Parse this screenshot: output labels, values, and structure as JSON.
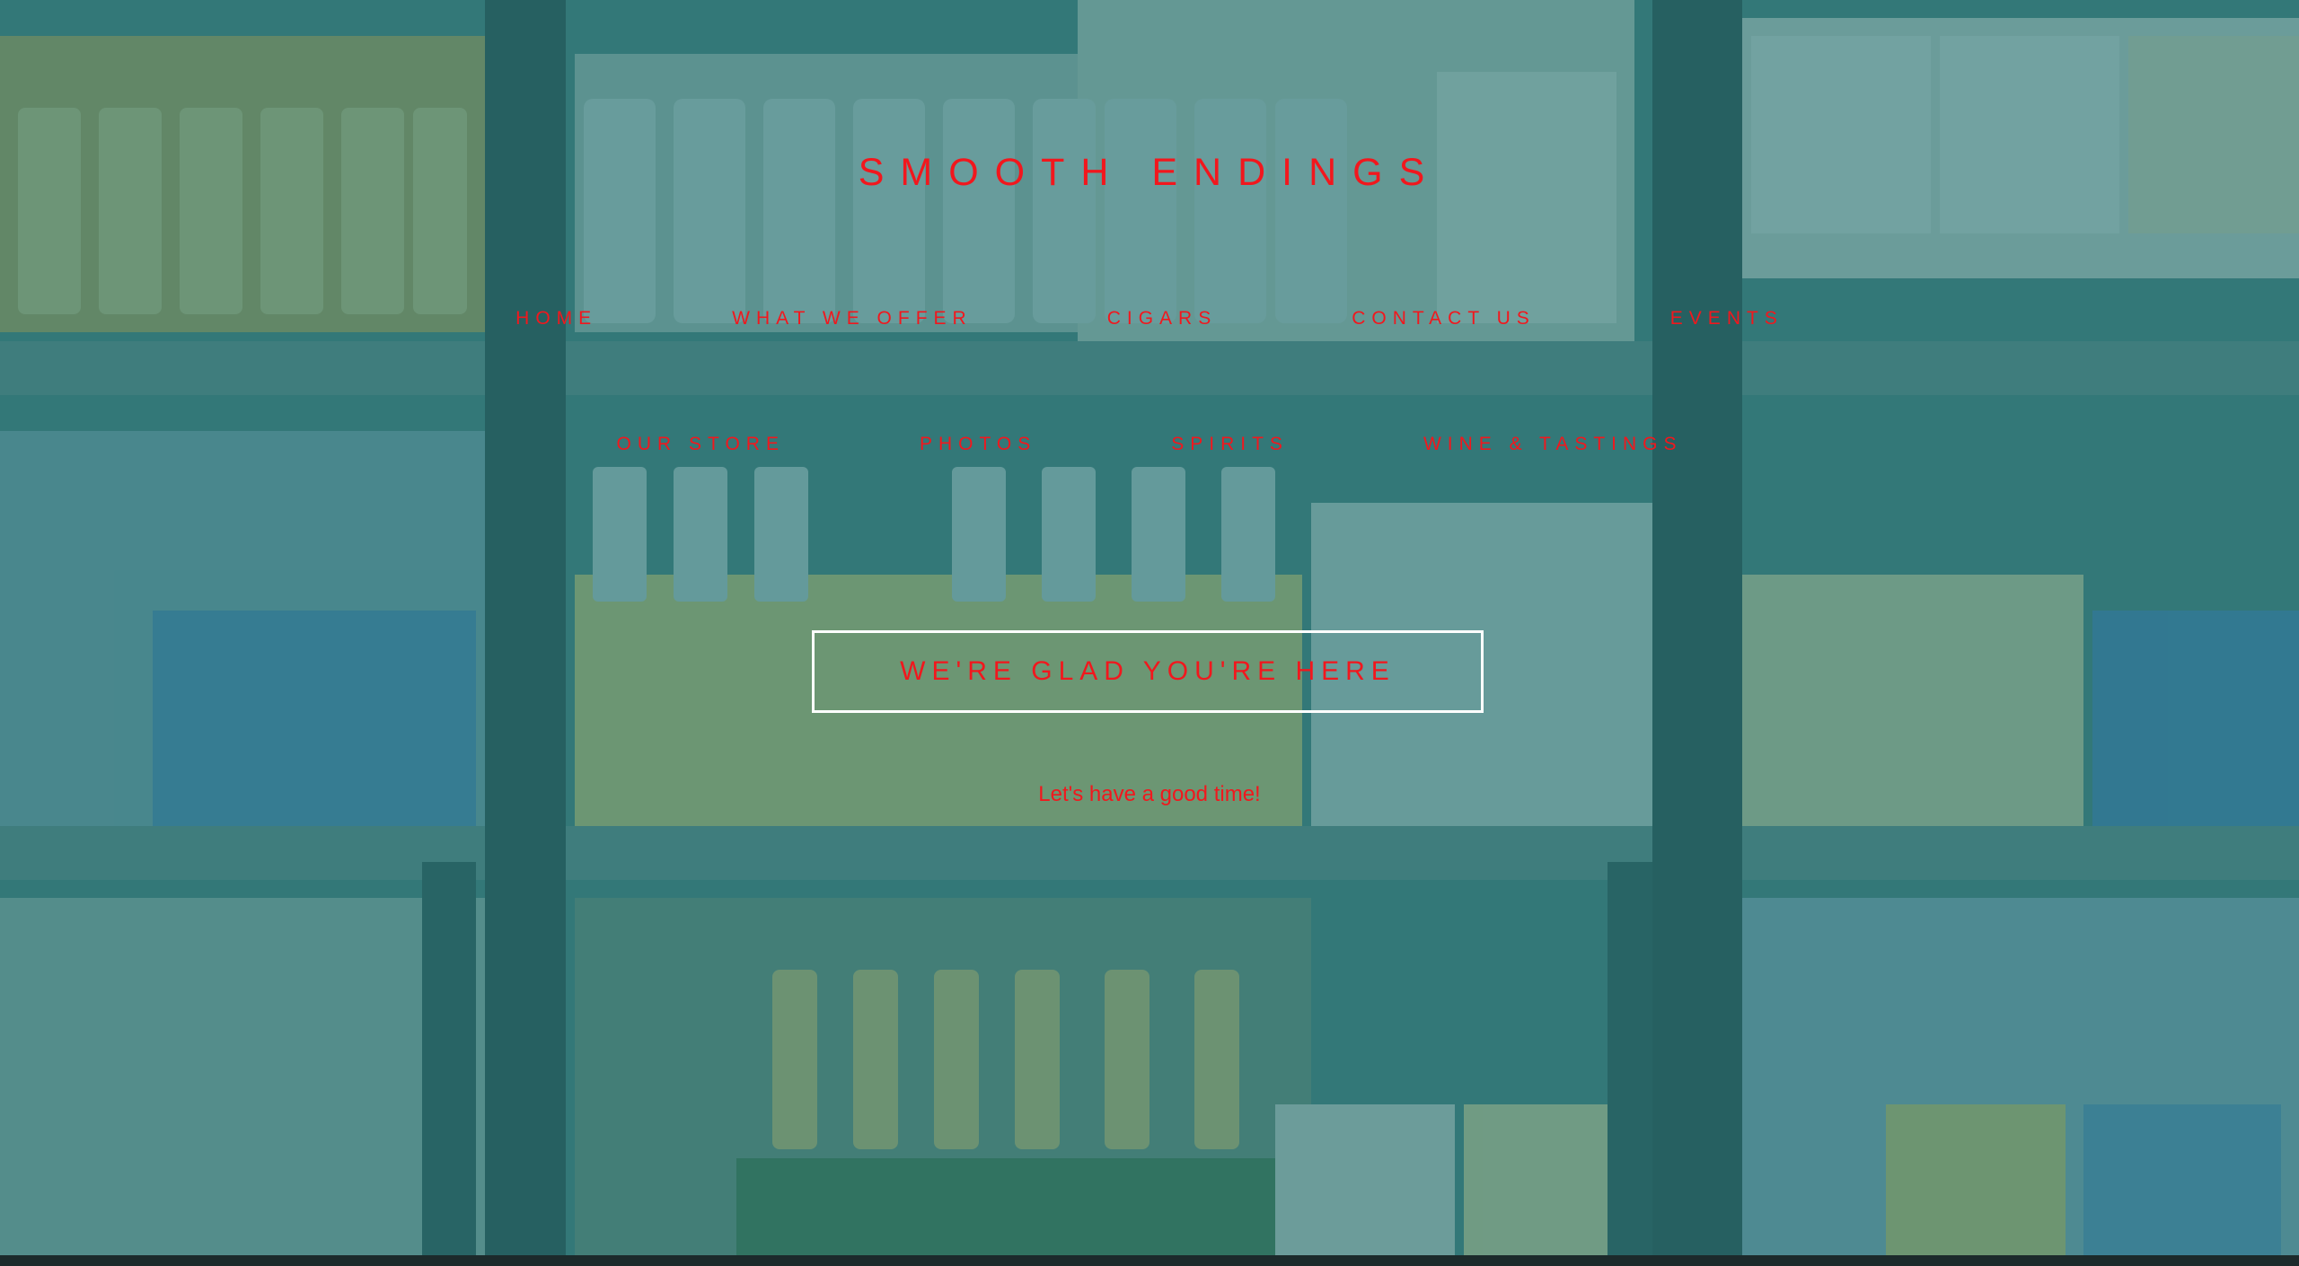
{
  "site": {
    "title": "SMOOTH ENDINGS"
  },
  "nav": {
    "row1": [
      "HOME",
      "WHAT WE OFFER",
      "CIGARS",
      "CONTACT US",
      "EVENTS"
    ],
    "row2": [
      "OUR STORE",
      "PHOTOS",
      "SPIRITS",
      "WINE & TASTINGS"
    ]
  },
  "hero": {
    "button_label": "WE'RE GLAD YOU'RE HERE",
    "tagline": "Let's have a good time!"
  },
  "colors": {
    "accent": "#f2171d",
    "overlay": "#2b7676",
    "button_border": "#ffffff"
  }
}
